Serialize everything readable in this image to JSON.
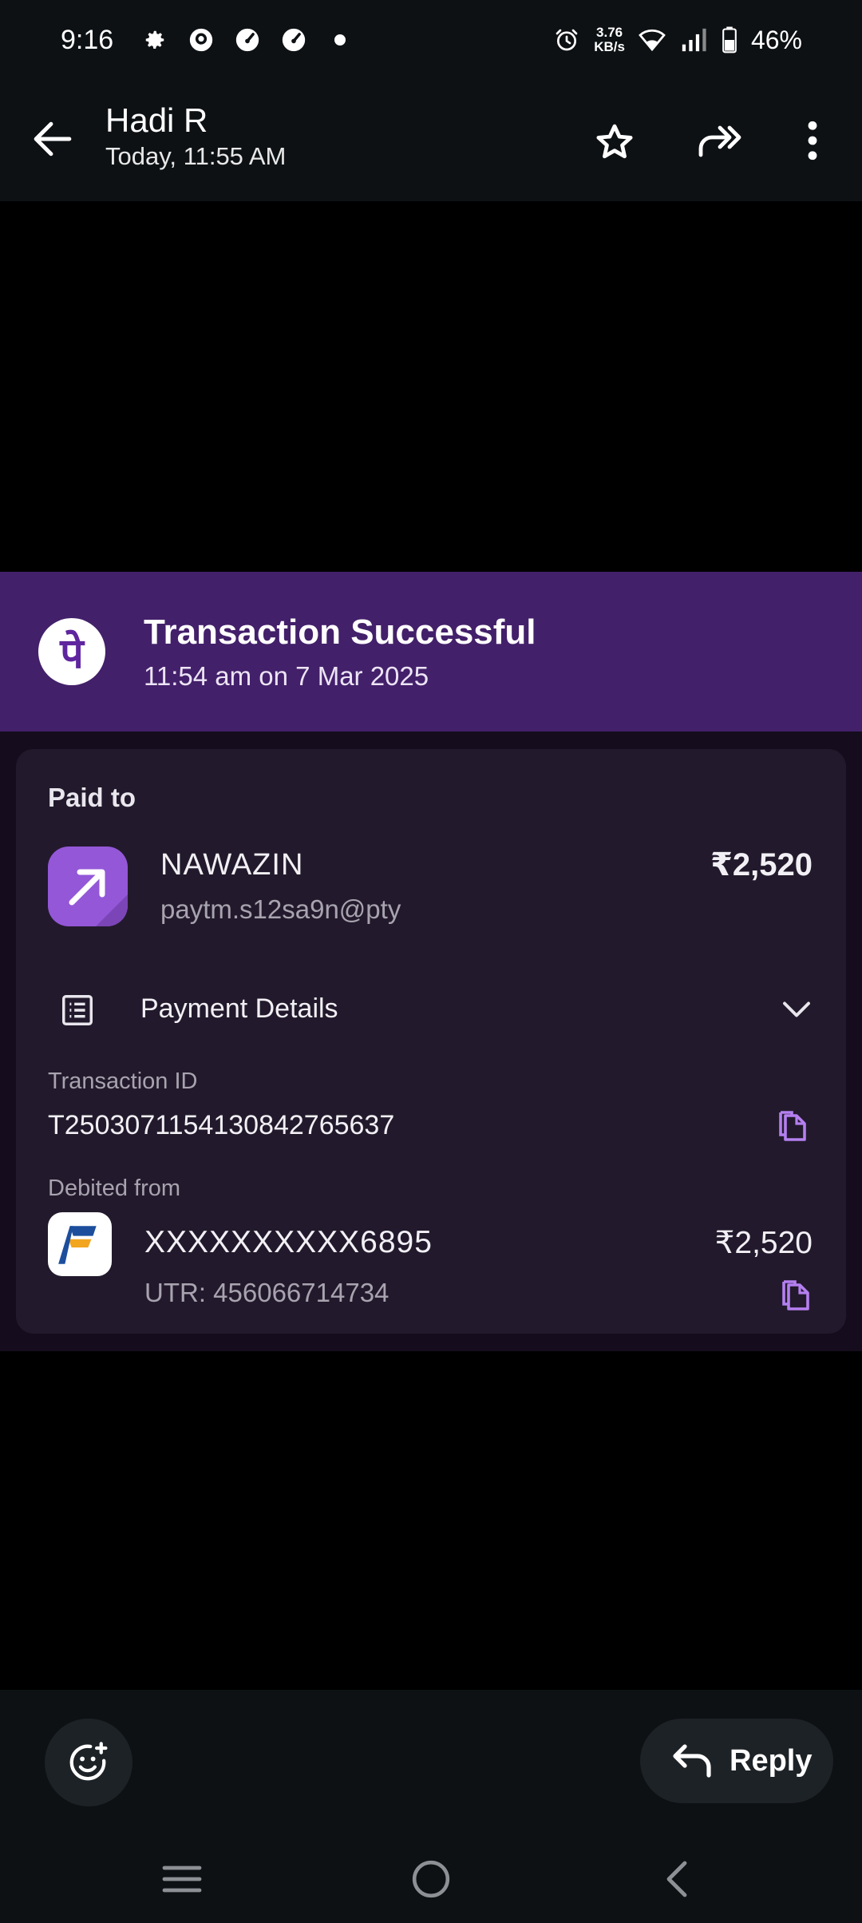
{
  "status_bar": {
    "time": "9:16",
    "net_speed_value": "3.76",
    "net_speed_unit": "KB/s",
    "battery": "46%",
    "icons": [
      "settings-icon",
      "chat-app-icon",
      "speedometer-icon",
      "speedometer-icon",
      "dot-icon",
      "alarm-icon",
      "wifi-icon",
      "signal-icon",
      "battery-icon"
    ]
  },
  "header": {
    "sender": "Hadi R",
    "timestamp": "Today, 11:55 AM",
    "actions": [
      "back-icon",
      "star-icon",
      "forward-icon",
      "more-icon"
    ]
  },
  "transaction": {
    "logo_glyph": "पे",
    "title": "Transaction Successful",
    "subtitle": "11:54 am on 7 Mar 2025",
    "paid_to_label": "Paid to",
    "payee_name": "NAWAZIN",
    "payee_vpa": "paytm.s12sa9n@pty",
    "amount": "₹2,520",
    "details_label": "Payment Details",
    "txn_id_label": "Transaction ID",
    "txn_id": "T2503071154130842765637",
    "debited_label": "Debited from",
    "account": "XXXXXXXXXX6895",
    "debit_amount": "₹2,520",
    "utr": "UTR: 456066714734"
  },
  "bottom": {
    "reply_label": "Reply"
  },
  "colors": {
    "banner": "#43206a",
    "card": "#221a2c",
    "accent": "#9457d8",
    "copy_icon": "#b57ff0",
    "bar": "#0d1114"
  }
}
